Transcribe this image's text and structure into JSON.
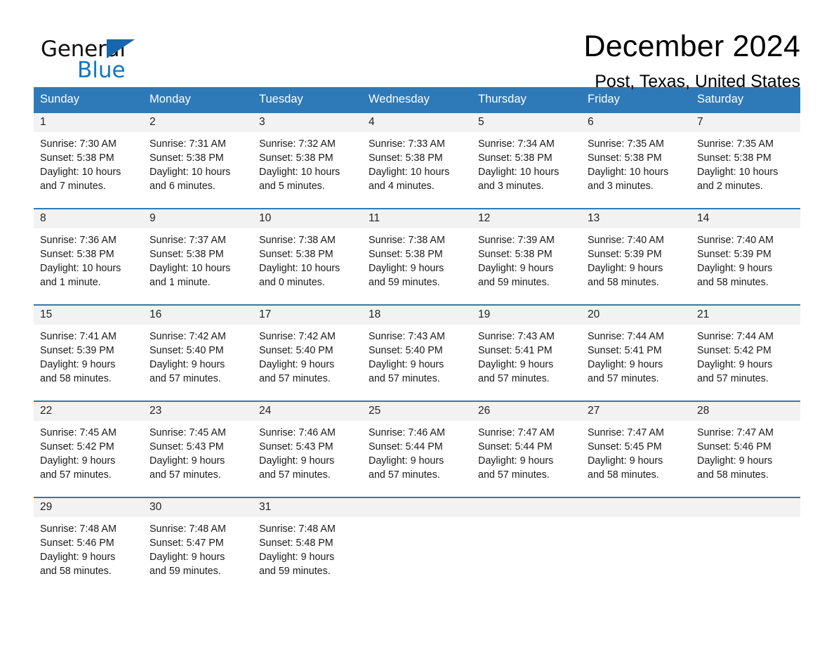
{
  "brand": {
    "word1": "General",
    "word2": "Blue",
    "triangle_color": "#1667ad",
    "blue_color": "#1376c4"
  },
  "header": {
    "title": "December 2024",
    "subtitle": "Post, Texas, United States",
    "header_bg": "#2e7ab8",
    "row_divider_color": "#2e7ab8",
    "daynum_band_bg": "#f2f2f2"
  },
  "weekday_headers": [
    "Sunday",
    "Monday",
    "Tuesday",
    "Wednesday",
    "Thursday",
    "Friday",
    "Saturday"
  ],
  "weeks": [
    [
      {
        "day": "1",
        "sunrise": "Sunrise: 7:30 AM",
        "sunset": "Sunset: 5:38 PM",
        "daylight_line1": "Daylight: 10 hours",
        "daylight_line2": "and 7 minutes."
      },
      {
        "day": "2",
        "sunrise": "Sunrise: 7:31 AM",
        "sunset": "Sunset: 5:38 PM",
        "daylight_line1": "Daylight: 10 hours",
        "daylight_line2": "and 6 minutes."
      },
      {
        "day": "3",
        "sunrise": "Sunrise: 7:32 AM",
        "sunset": "Sunset: 5:38 PM",
        "daylight_line1": "Daylight: 10 hours",
        "daylight_line2": "and 5 minutes."
      },
      {
        "day": "4",
        "sunrise": "Sunrise: 7:33 AM",
        "sunset": "Sunset: 5:38 PM",
        "daylight_line1": "Daylight: 10 hours",
        "daylight_line2": "and 4 minutes."
      },
      {
        "day": "5",
        "sunrise": "Sunrise: 7:34 AM",
        "sunset": "Sunset: 5:38 PM",
        "daylight_line1": "Daylight: 10 hours",
        "daylight_line2": "and 3 minutes."
      },
      {
        "day": "6",
        "sunrise": "Sunrise: 7:35 AM",
        "sunset": "Sunset: 5:38 PM",
        "daylight_line1": "Daylight: 10 hours",
        "daylight_line2": "and 3 minutes."
      },
      {
        "day": "7",
        "sunrise": "Sunrise: 7:35 AM",
        "sunset": "Sunset: 5:38 PM",
        "daylight_line1": "Daylight: 10 hours",
        "daylight_line2": "and 2 minutes."
      }
    ],
    [
      {
        "day": "8",
        "sunrise": "Sunrise: 7:36 AM",
        "sunset": "Sunset: 5:38 PM",
        "daylight_line1": "Daylight: 10 hours",
        "daylight_line2": "and 1 minute."
      },
      {
        "day": "9",
        "sunrise": "Sunrise: 7:37 AM",
        "sunset": "Sunset: 5:38 PM",
        "daylight_line1": "Daylight: 10 hours",
        "daylight_line2": "and 1 minute."
      },
      {
        "day": "10",
        "sunrise": "Sunrise: 7:38 AM",
        "sunset": "Sunset: 5:38 PM",
        "daylight_line1": "Daylight: 10 hours",
        "daylight_line2": "and 0 minutes."
      },
      {
        "day": "11",
        "sunrise": "Sunrise: 7:38 AM",
        "sunset": "Sunset: 5:38 PM",
        "daylight_line1": "Daylight: 9 hours",
        "daylight_line2": "and 59 minutes."
      },
      {
        "day": "12",
        "sunrise": "Sunrise: 7:39 AM",
        "sunset": "Sunset: 5:38 PM",
        "daylight_line1": "Daylight: 9 hours",
        "daylight_line2": "and 59 minutes."
      },
      {
        "day": "13",
        "sunrise": "Sunrise: 7:40 AM",
        "sunset": "Sunset: 5:39 PM",
        "daylight_line1": "Daylight: 9 hours",
        "daylight_line2": "and 58 minutes."
      },
      {
        "day": "14",
        "sunrise": "Sunrise: 7:40 AM",
        "sunset": "Sunset: 5:39 PM",
        "daylight_line1": "Daylight: 9 hours",
        "daylight_line2": "and 58 minutes."
      }
    ],
    [
      {
        "day": "15",
        "sunrise": "Sunrise: 7:41 AM",
        "sunset": "Sunset: 5:39 PM",
        "daylight_line1": "Daylight: 9 hours",
        "daylight_line2": "and 58 minutes."
      },
      {
        "day": "16",
        "sunrise": "Sunrise: 7:42 AM",
        "sunset": "Sunset: 5:40 PM",
        "daylight_line1": "Daylight: 9 hours",
        "daylight_line2": "and 57 minutes."
      },
      {
        "day": "17",
        "sunrise": "Sunrise: 7:42 AM",
        "sunset": "Sunset: 5:40 PM",
        "daylight_line1": "Daylight: 9 hours",
        "daylight_line2": "and 57 minutes."
      },
      {
        "day": "18",
        "sunrise": "Sunrise: 7:43 AM",
        "sunset": "Sunset: 5:40 PM",
        "daylight_line1": "Daylight: 9 hours",
        "daylight_line2": "and 57 minutes."
      },
      {
        "day": "19",
        "sunrise": "Sunrise: 7:43 AM",
        "sunset": "Sunset: 5:41 PM",
        "daylight_line1": "Daylight: 9 hours",
        "daylight_line2": "and 57 minutes."
      },
      {
        "day": "20",
        "sunrise": "Sunrise: 7:44 AM",
        "sunset": "Sunset: 5:41 PM",
        "daylight_line1": "Daylight: 9 hours",
        "daylight_line2": "and 57 minutes."
      },
      {
        "day": "21",
        "sunrise": "Sunrise: 7:44 AM",
        "sunset": "Sunset: 5:42 PM",
        "daylight_line1": "Daylight: 9 hours",
        "daylight_line2": "and 57 minutes."
      }
    ],
    [
      {
        "day": "22",
        "sunrise": "Sunrise: 7:45 AM",
        "sunset": "Sunset: 5:42 PM",
        "daylight_line1": "Daylight: 9 hours",
        "daylight_line2": "and 57 minutes."
      },
      {
        "day": "23",
        "sunrise": "Sunrise: 7:45 AM",
        "sunset": "Sunset: 5:43 PM",
        "daylight_line1": "Daylight: 9 hours",
        "daylight_line2": "and 57 minutes."
      },
      {
        "day": "24",
        "sunrise": "Sunrise: 7:46 AM",
        "sunset": "Sunset: 5:43 PM",
        "daylight_line1": "Daylight: 9 hours",
        "daylight_line2": "and 57 minutes."
      },
      {
        "day": "25",
        "sunrise": "Sunrise: 7:46 AM",
        "sunset": "Sunset: 5:44 PM",
        "daylight_line1": "Daylight: 9 hours",
        "daylight_line2": "and 57 minutes."
      },
      {
        "day": "26",
        "sunrise": "Sunrise: 7:47 AM",
        "sunset": "Sunset: 5:44 PM",
        "daylight_line1": "Daylight: 9 hours",
        "daylight_line2": "and 57 minutes."
      },
      {
        "day": "27",
        "sunrise": "Sunrise: 7:47 AM",
        "sunset": "Sunset: 5:45 PM",
        "daylight_line1": "Daylight: 9 hours",
        "daylight_line2": "and 58 minutes."
      },
      {
        "day": "28",
        "sunrise": "Sunrise: 7:47 AM",
        "sunset": "Sunset: 5:46 PM",
        "daylight_line1": "Daylight: 9 hours",
        "daylight_line2": "and 58 minutes."
      }
    ],
    [
      {
        "day": "29",
        "sunrise": "Sunrise: 7:48 AM",
        "sunset": "Sunset: 5:46 PM",
        "daylight_line1": "Daylight: 9 hours",
        "daylight_line2": "and 58 minutes."
      },
      {
        "day": "30",
        "sunrise": "Sunrise: 7:48 AM",
        "sunset": "Sunset: 5:47 PM",
        "daylight_line1": "Daylight: 9 hours",
        "daylight_line2": "and 59 minutes."
      },
      {
        "day": "31",
        "sunrise": "Sunrise: 7:48 AM",
        "sunset": "Sunset: 5:48 PM",
        "daylight_line1": "Daylight: 9 hours",
        "daylight_line2": "and 59 minutes."
      },
      {
        "day": "",
        "sunrise": "",
        "sunset": "",
        "daylight_line1": "",
        "daylight_line2": ""
      },
      {
        "day": "",
        "sunrise": "",
        "sunset": "",
        "daylight_line1": "",
        "daylight_line2": ""
      },
      {
        "day": "",
        "sunrise": "",
        "sunset": "",
        "daylight_line1": "",
        "daylight_line2": ""
      },
      {
        "day": "",
        "sunrise": "",
        "sunset": "",
        "daylight_line1": "",
        "daylight_line2": ""
      }
    ]
  ]
}
